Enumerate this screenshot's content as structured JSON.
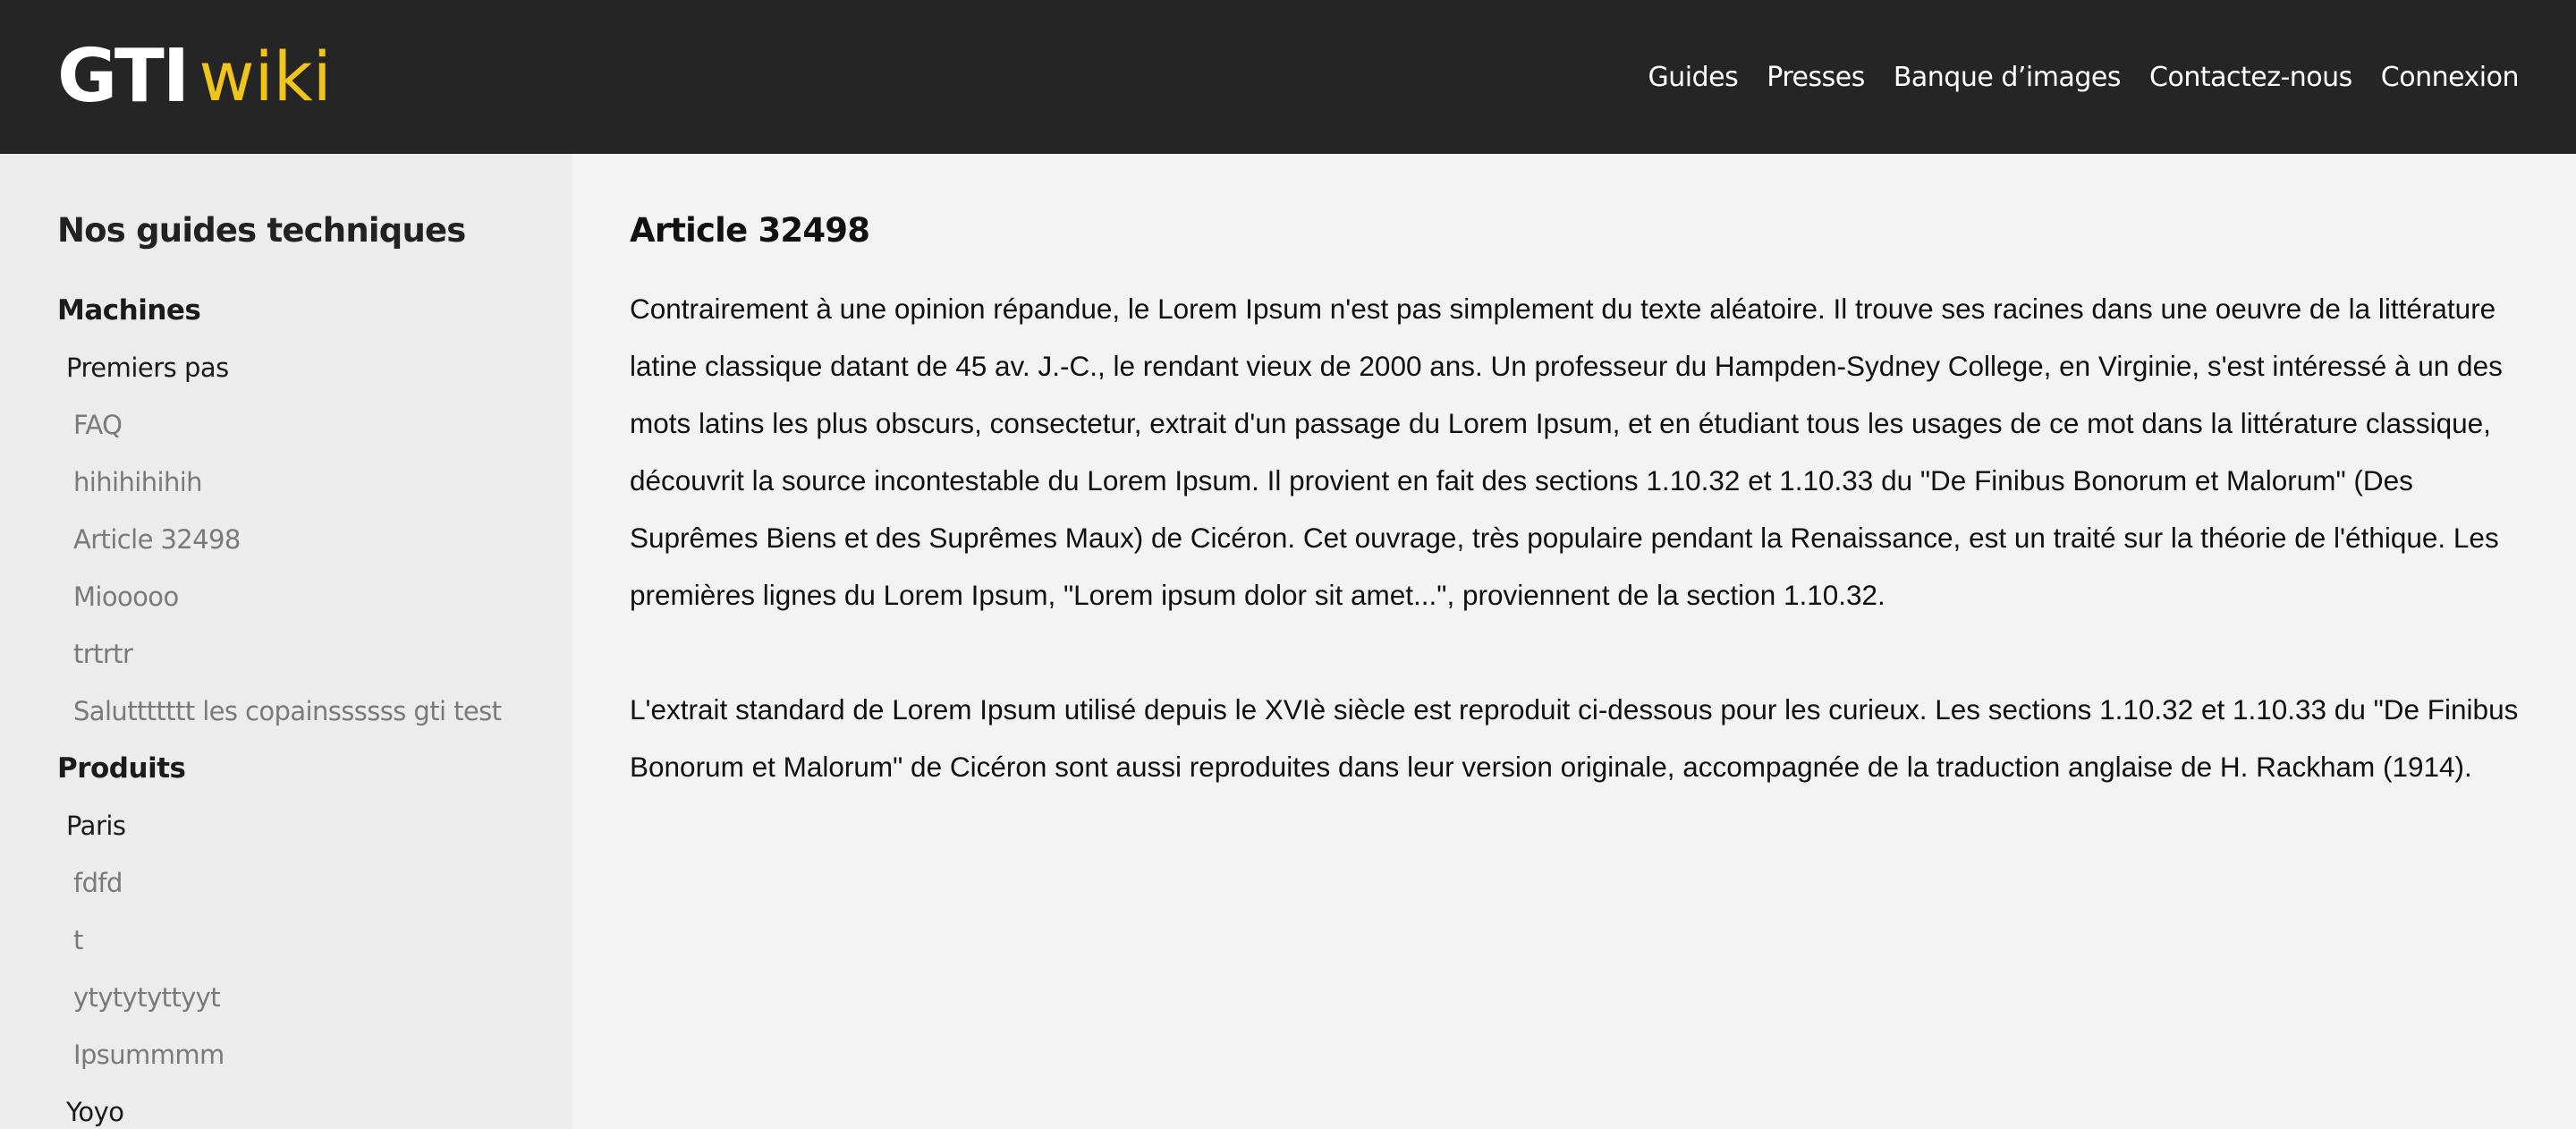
{
  "header": {
    "logo_main": "GTI",
    "logo_accent": "wiki",
    "nav": [
      "Guides",
      "Presses",
      "Banque d’images",
      "Contactez-nous",
      "Connexion"
    ]
  },
  "sidebar": {
    "title": "Nos guides techniques",
    "categories": [
      {
        "label": "Machines",
        "subcategories": [
          {
            "label": "Premiers pas",
            "articles": [
              "FAQ",
              "hihihihihih",
              "Article 32498",
              "Miooooo",
              "trtrtr",
              "Saluttttttt les copainssssss gti test"
            ]
          }
        ]
      },
      {
        "label": "Produits",
        "subcategories": [
          {
            "label": "Paris",
            "articles": [
              "fdfd",
              "t",
              "ytytytyttyyt",
              "Ipsummmm"
            ]
          },
          {
            "label": "Yoyo",
            "articles": []
          }
        ]
      }
    ]
  },
  "main": {
    "title": "Article 32498",
    "paragraphs": [
      "Contrairement à une opinion répandue, le Lorem Ipsum n'est pas simplement du texte aléatoire. Il trouve ses racines dans une oeuvre de la littérature latine classique datant de 45 av. J.-C., le rendant vieux de 2000 ans. Un professeur du Hampden-Sydney College, en Virginie, s'est intéressé à un des mots latins les plus obscurs, consectetur, extrait d'un passage du Lorem Ipsum, et en étudiant tous les usages de ce mot dans la littérature classique, découvrit la source incontestable du Lorem Ipsum. Il provient en fait des sections 1.10.32 et 1.10.33 du \"De Finibus Bonorum et Malorum\" (Des Suprêmes Biens et des Suprêmes Maux) de Cicéron. Cet ouvrage, très populaire pendant la Renaissance, est un traité sur la théorie de l'éthique. Les premières lignes du Lorem Ipsum, \"Lorem ipsum dolor sit amet...\", proviennent de la section 1.10.32.",
      "L'extrait standard de Lorem Ipsum utilisé depuis le XVIè siècle est reproduit ci-dessous pour les curieux. Les sections 1.10.32 et 1.10.33 du \"De Finibus Bonorum et Malorum\" de Cicéron sont aussi reproduites dans leur version originale, accompagnée de la traduction anglaise de H. Rackham (1914)."
    ]
  },
  "colors": {
    "header_bg": "#252525",
    "logo_accent": "#f0c419",
    "sidebar_bg": "#ececec",
    "content_bg": "#f3f3f3",
    "article_link": "#7a7a7a"
  }
}
